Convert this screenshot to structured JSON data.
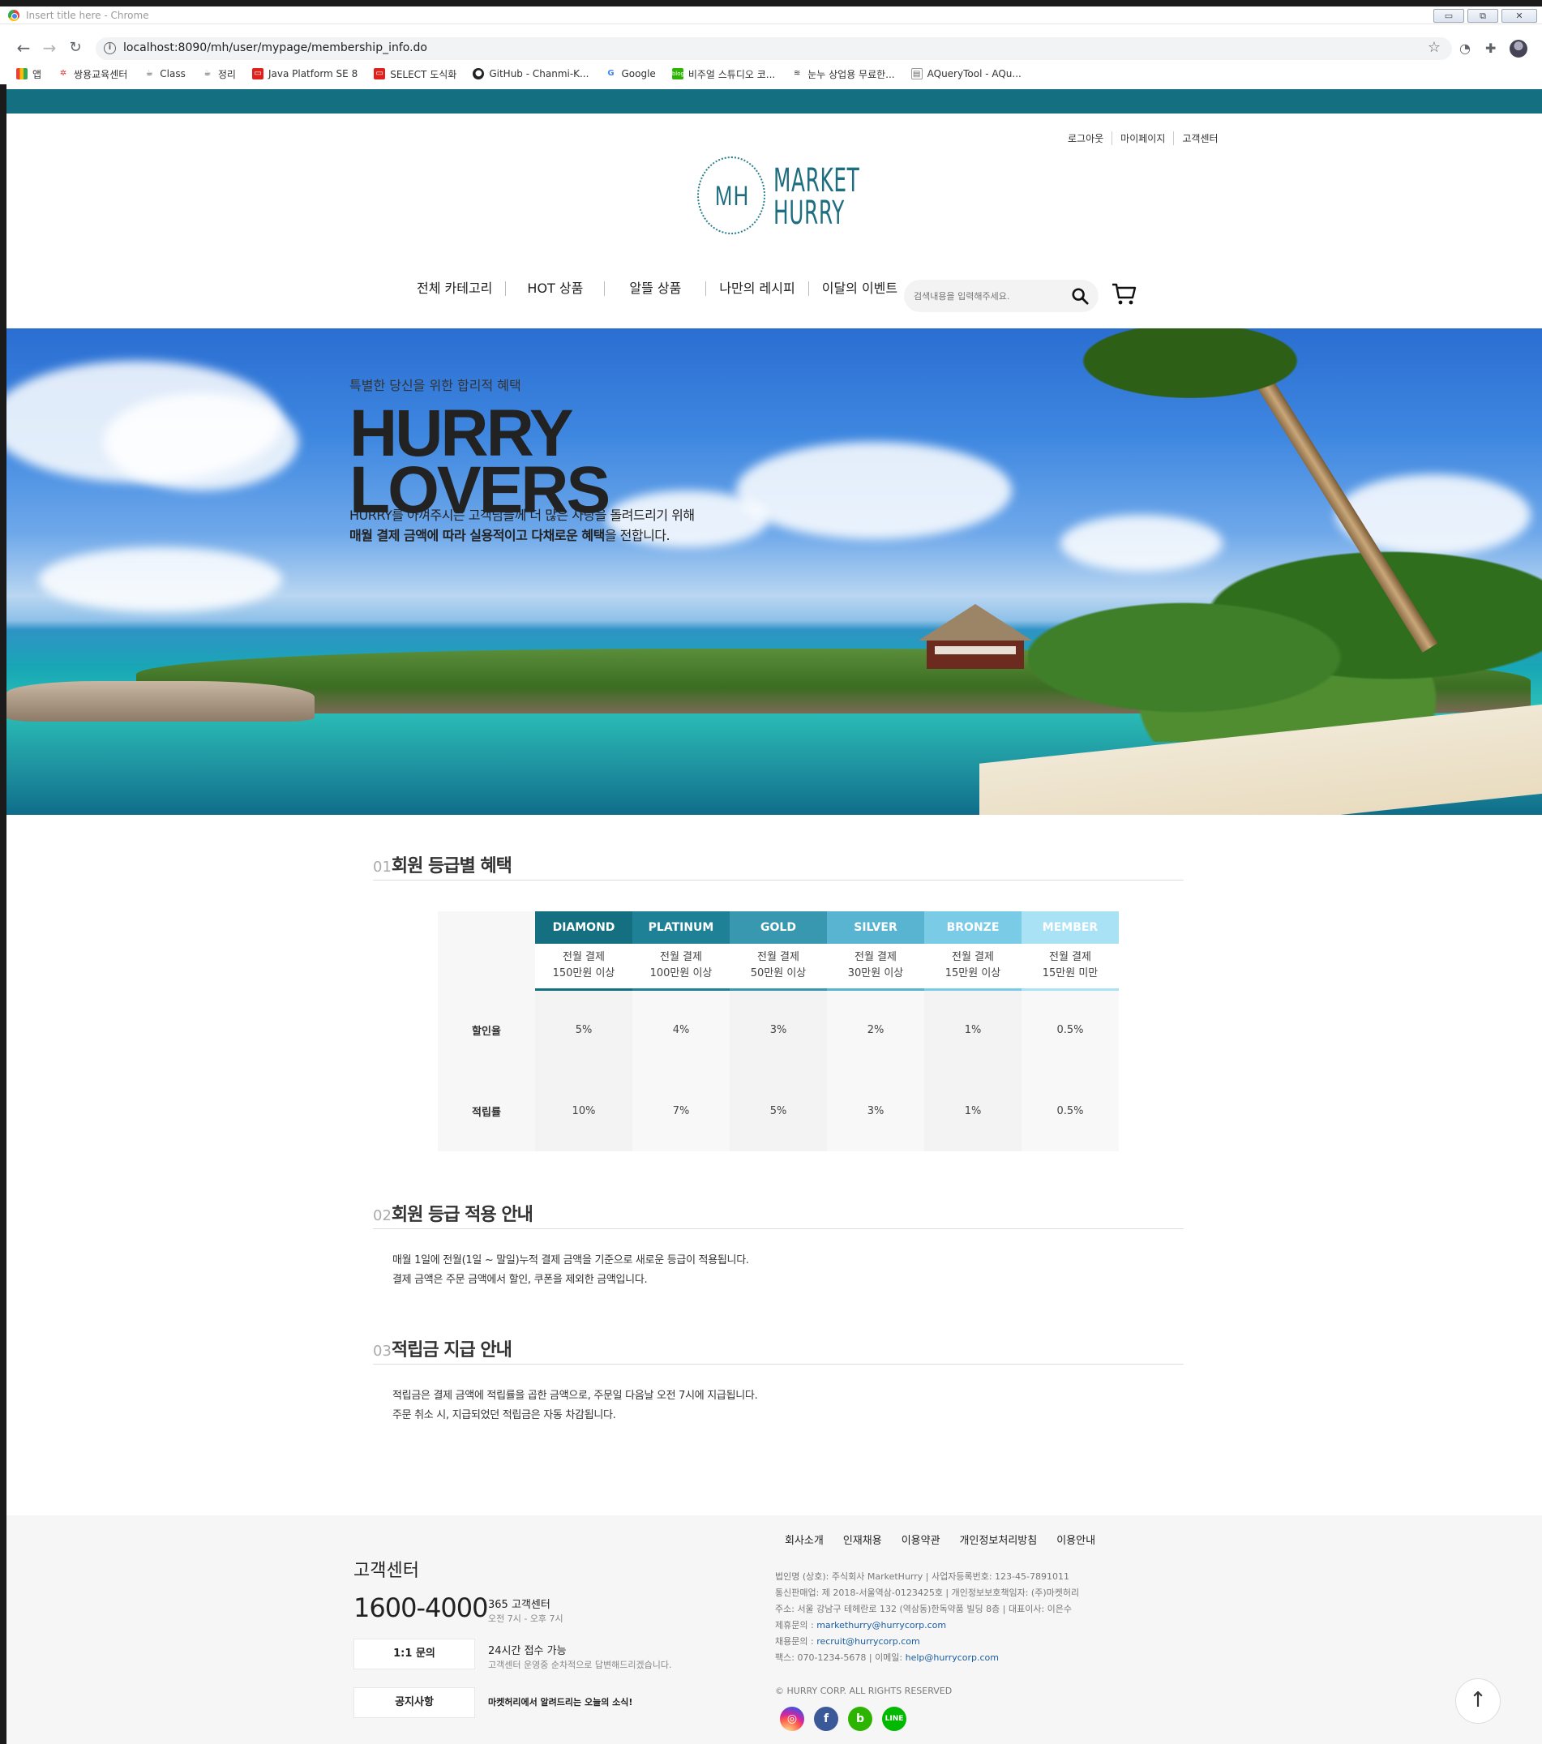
{
  "window": {
    "title": "Insert title here - Chrome",
    "controls": [
      "▭",
      "⧉",
      "✕"
    ]
  },
  "browser": {
    "url": "localhost:8090/mh/user/mypage/membership_info.do",
    "bookmarks": [
      {
        "label": "앱",
        "icon": "apps-grid-icon"
      },
      {
        "label": "쌍용교육센터",
        "icon": "ssangyong-icon"
      },
      {
        "label": "Class",
        "icon": "coffee-icon"
      },
      {
        "label": "정리",
        "icon": "coffee-icon"
      },
      {
        "label": "Java Platform SE 8",
        "icon": "oracle-icon"
      },
      {
        "label": "SELECT 도식화",
        "icon": "oracle-icon"
      },
      {
        "label": "GitHub - Chanmi-K...",
        "icon": "github-icon"
      },
      {
        "label": "Google",
        "icon": "google-icon"
      },
      {
        "label": "비주얼 스튜디오 코...",
        "icon": "blog-icon"
      },
      {
        "label": "눈누 상업용 무료한...",
        "icon": "noonnu-icon"
      },
      {
        "label": "AQueryTool - AQu...",
        "icon": "doc-icon"
      }
    ]
  },
  "header": {
    "util_links": [
      "로그아웃",
      "마이페이지",
      "고객센터"
    ],
    "logo": {
      "mark": "MH",
      "line1": "MARKET",
      "line2": "HURRY"
    },
    "nav": [
      "전체 카테고리",
      "HOT 상품",
      "알뜰 상품",
      "나만의 레시피",
      "이달의 이벤트"
    ],
    "search_placeholder": "검색내용을 입력해주세요."
  },
  "hero": {
    "tagline": "특별한 당신을 위한 합리적 혜택",
    "title_line1": "HURRY",
    "title_line2": "LOVERS",
    "desc_line1": "HURRY를 아껴주시는 고객님들께 더 많은 사랑을 돌려드리기 위해",
    "desc_line2_bold": "매월 결제 금액에 따라 실용적이고 다채로운 혜택",
    "desc_line2_rest": "을 전합니다."
  },
  "sections": {
    "s1": {
      "num": "01",
      "title": "회원 등급별 혜택"
    },
    "s2": {
      "num": "02",
      "title": "회원 등급 적용 안내",
      "lines": [
        "매월 1일에 전월(1일 ~ 말일)누적 결제 금액을 기준으로 새로운 등급이 적용됩니다.",
        "결제 금액은 주문 금액에서 할인, 쿠폰을 제외한 금액입니다."
      ]
    },
    "s3": {
      "num": "03",
      "title": "적립금 지급 안내",
      "lines": [
        "적립금은 결제 금액에 적립률을 곱한 금액으로, 주문일 다음날 오전 7시에 지급됩니다.",
        "주문 취소 시, 지급되었던 적립금은 자동 차감됩니다."
      ]
    }
  },
  "grades": {
    "row_labels": {
      "discount": "할인율",
      "points": "적립률"
    },
    "tiers": [
      {
        "name": "DIAMOND",
        "cond1": "전월 결제",
        "cond2": "150만원 이상",
        "discount": "5%",
        "points": "10%",
        "color": "#146f80"
      },
      {
        "name": "PLATINUM",
        "cond1": "전월 결제",
        "cond2": "100만원 이상",
        "discount": "4%",
        "points": "7%",
        "color": "#1f8196"
      },
      {
        "name": "GOLD",
        "cond1": "전월 결제",
        "cond2": "50만원 이상",
        "discount": "3%",
        "points": "5%",
        "color": "#3898b0"
      },
      {
        "name": "SILVER",
        "cond1": "전월 결제",
        "cond2": "30만원 이상",
        "discount": "2%",
        "points": "3%",
        "color": "#58b4d0"
      },
      {
        "name": "BRONZE",
        "cond1": "전월 결제",
        "cond2": "15만원 이상",
        "discount": "1%",
        "points": "1%",
        "color": "#7acbe6"
      },
      {
        "name": "MEMBER",
        "cond1": "전월 결제",
        "cond2": "15만원 미만",
        "discount": "0.5%",
        "points": "0.5%",
        "color": "#a9e2f4"
      }
    ]
  },
  "footer": {
    "cs_title": "고객센터",
    "phone": "1600-4000",
    "phone_label": "365 고객센터",
    "phone_hours": "오전 7시 - 오후 7시",
    "inquiry_btn": "1:1 문의",
    "inquiry_label": "24시간 접수 가능",
    "inquiry_sub": "고객센터 운영중 순차적으로 답변해드리겠습니다.",
    "notice_btn": "공지사항",
    "notice_label": "마켓허리에서 알려드리는 오늘의 소식!",
    "nav": [
      "회사소개",
      "인재채용",
      "이용약관",
      "개인정보처리방침",
      "이용안내"
    ],
    "info": {
      "line1": "법인명 (상호): 주식회사 MarketHurry  |  사업자등록번호: 123-45-7891011",
      "line2": "통신판매업: 제 2018-서울역삼-0123425호  |  개인정보보호책임자: (주)마켓허리",
      "line3": "주소: 서울 강남구 테헤란로 132 (역삼동)한독약품 빌딩 8층  |  대표이사: 이은수",
      "line4_label": "제휴문의 : ",
      "line4_link": "markethurry@hurrycorp.com",
      "line5_label": "채용문의 : ",
      "line5_link": "recruit@hurrycorp.com",
      "line6_label": "팩스: 070-1234-5678  |  이메일: ",
      "line6_link": "help@hurrycorp.com"
    },
    "copyright": "© HURRY CORP. ALL RIGHTS RESERVED",
    "sns": [
      {
        "icon": "instagram-icon",
        "color": "#d6249f"
      },
      {
        "icon": "facebook-icon",
        "color": "#3b5998"
      },
      {
        "icon": "blog-icon",
        "color": "#2db400"
      },
      {
        "icon": "line-icon",
        "color": "#00b900"
      }
    ]
  },
  "colors": {
    "accent": "#146f80",
    "hero_text": "#222222"
  }
}
